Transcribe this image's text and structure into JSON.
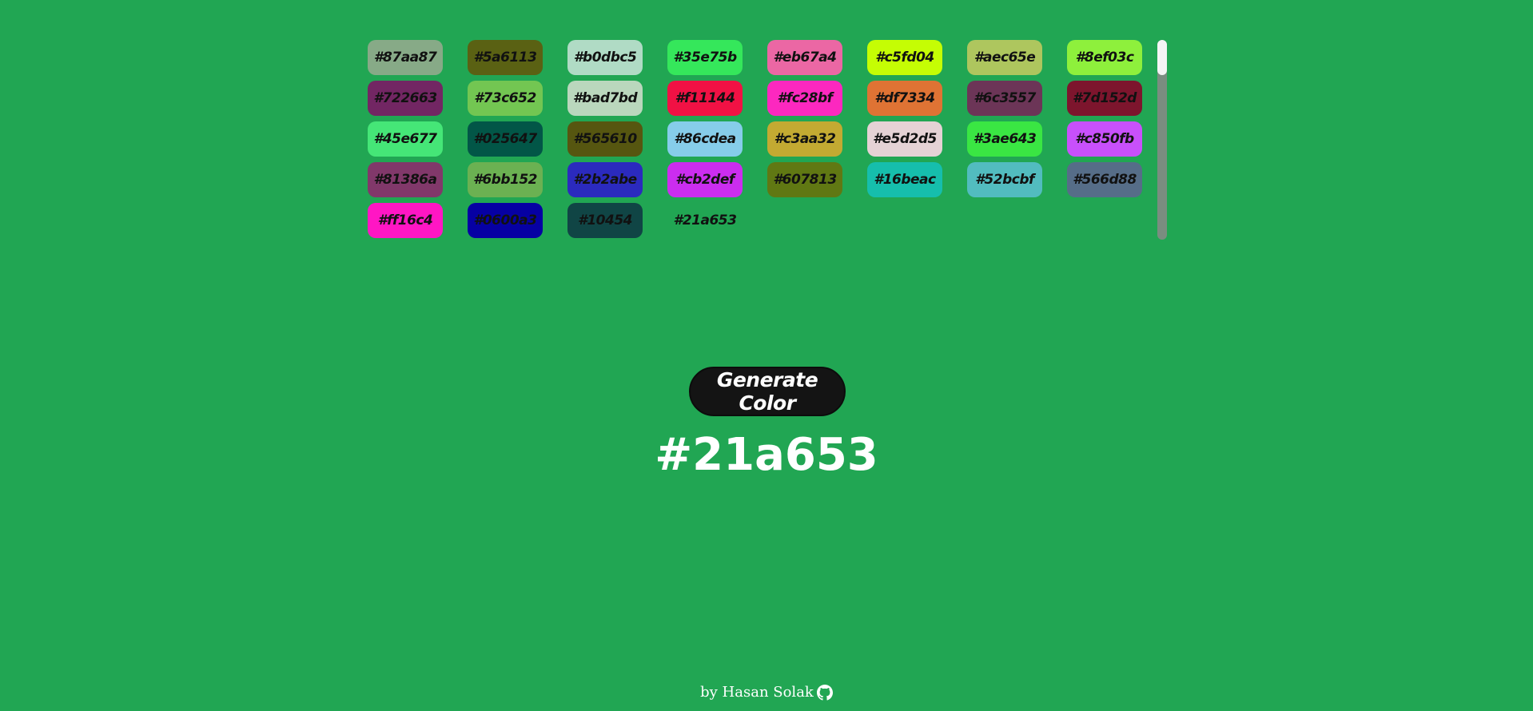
{
  "palette": {
    "swatches": [
      {
        "label": "#87aa87",
        "color": "#87aa87"
      },
      {
        "label": "#5a6113",
        "color": "#5a6113"
      },
      {
        "label": "#b0dbc5",
        "color": "#b0dbc5"
      },
      {
        "label": "#35e75b",
        "color": "#35e75b"
      },
      {
        "label": "#eb67a4",
        "color": "#eb67a4"
      },
      {
        "label": "#c5fd04",
        "color": "#c5fd04"
      },
      {
        "label": "#aec65e",
        "color": "#aec65e"
      },
      {
        "label": "#8ef03c",
        "color": "#8ef03c"
      },
      {
        "label": "#722663",
        "color": "#722663"
      },
      {
        "label": "#73c652",
        "color": "#73c652"
      },
      {
        "label": "#bad7bd",
        "color": "#bad7bd"
      },
      {
        "label": "#f11144",
        "color": "#f11144"
      },
      {
        "label": "#fc28bf",
        "color": "#fc28bf"
      },
      {
        "label": "#df7334",
        "color": "#df7334"
      },
      {
        "label": "#6c3557",
        "color": "#6c3557"
      },
      {
        "label": "#7d152d",
        "color": "#7d152d"
      },
      {
        "label": "#45e677",
        "color": "#45e677"
      },
      {
        "label": "#025647",
        "color": "#025647"
      },
      {
        "label": "#565610",
        "color": "#565610"
      },
      {
        "label": "#86cdea",
        "color": "#86cdea"
      },
      {
        "label": "#c3aa32",
        "color": "#c3aa32"
      },
      {
        "label": "#e5d2d5",
        "color": "#e5d2d5"
      },
      {
        "label": "#3ae643",
        "color": "#3ae643"
      },
      {
        "label": "#c850fb",
        "color": "#c850fb"
      },
      {
        "label": "#81386a",
        "color": "#81386a"
      },
      {
        "label": "#6bb152",
        "color": "#6bb152"
      },
      {
        "label": "#2b2abe",
        "color": "#2b2abe"
      },
      {
        "label": "#cb2def",
        "color": "#cb2def"
      },
      {
        "label": "#607813",
        "color": "#607813"
      },
      {
        "label": "#16beac",
        "color": "#16beac"
      },
      {
        "label": "#52bcbf",
        "color": "#52bcbf"
      },
      {
        "label": "#566d88",
        "color": "#566d88"
      },
      {
        "label": "#ff16c4",
        "color": "#ff16c4"
      },
      {
        "label": "#0600a3",
        "color": "#0600a3"
      },
      {
        "label": "#10454",
        "color": "#104545"
      },
      {
        "label": "#21a653",
        "color": "#21a653"
      }
    ],
    "scrollbar_position": 0
  },
  "generate_button": {
    "label": "Generate Color"
  },
  "current_color": {
    "value": "#21a653"
  },
  "background_color": "#21a653",
  "footer": {
    "text": "by Hasan Solak",
    "icon": "github-icon"
  }
}
